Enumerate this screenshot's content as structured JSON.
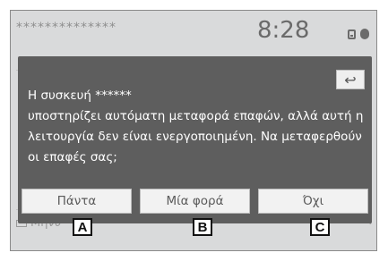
{
  "status_bar": {
    "device_mask": "**************",
    "clock": "8:28"
  },
  "background": {
    "message_label": "Μήνυ"
  },
  "dialog": {
    "back_symbol": "↩",
    "lines": [
      "Η συσκευή ******",
      "υποστηρίζει αυτόματη μεταφορά επαφών, αλλά αυτή η",
      "λειτουργία δεν είναι ενεργοποιημένη. Να μεταφερθούν",
      "οι επαφές σας;"
    ],
    "buttons": {
      "always": "Πάντα",
      "once": "Μία φορά",
      "no": "Όχι"
    }
  },
  "callouts": [
    "A",
    "B",
    "C"
  ]
}
